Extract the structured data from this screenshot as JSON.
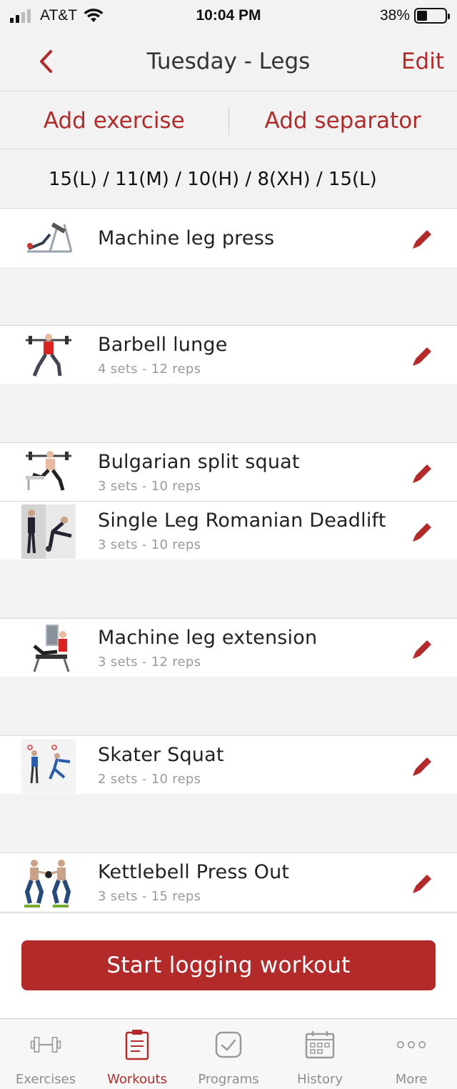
{
  "status_bar": {
    "carrier": "AT&T",
    "time": "10:04 PM",
    "battery": "38%",
    "battery_level": 0.38
  },
  "nav": {
    "title": "Tuesday - Legs",
    "edit_label": "Edit",
    "back_icon": "chevron-left-icon"
  },
  "actions": {
    "add_exercise": "Add exercise",
    "add_separator": "Add separator"
  },
  "scheme": "15(L) / 11(M) / 10(H) / 8(XH) / 15(L)",
  "exercises": [
    {
      "name": "Machine leg press",
      "detail": ""
    },
    {
      "name": "Barbell lunge",
      "detail": "4 sets - 12 reps"
    },
    {
      "name": "Bulgarian split squat",
      "detail": "3 sets - 10 reps"
    },
    {
      "name": "Single Leg Romanian Deadlift",
      "detail": "3 sets - 10 reps"
    },
    {
      "name": "Machine leg extension",
      "detail": "3 sets - 12 reps"
    },
    {
      "name": "Skater Squat",
      "detail": "2 sets - 10 reps"
    },
    {
      "name": "Kettlebell Press Out",
      "detail": "3 sets - 15 reps"
    }
  ],
  "start_button": "Start logging workout",
  "tabs": [
    {
      "label": "Exercises",
      "icon": "dumbbell-icon",
      "active": false
    },
    {
      "label": "Workouts",
      "icon": "clipboard-icon",
      "active": true
    },
    {
      "label": "Programs",
      "icon": "checkbox-icon",
      "active": false
    },
    {
      "label": "History",
      "icon": "calendar-icon",
      "active": false
    },
    {
      "label": "More",
      "icon": "more-icon",
      "active": false
    }
  ],
  "colors": {
    "accent": "#b22b2a",
    "background": "#f2f2f2",
    "inactive_tab": "#8e8e8e"
  }
}
